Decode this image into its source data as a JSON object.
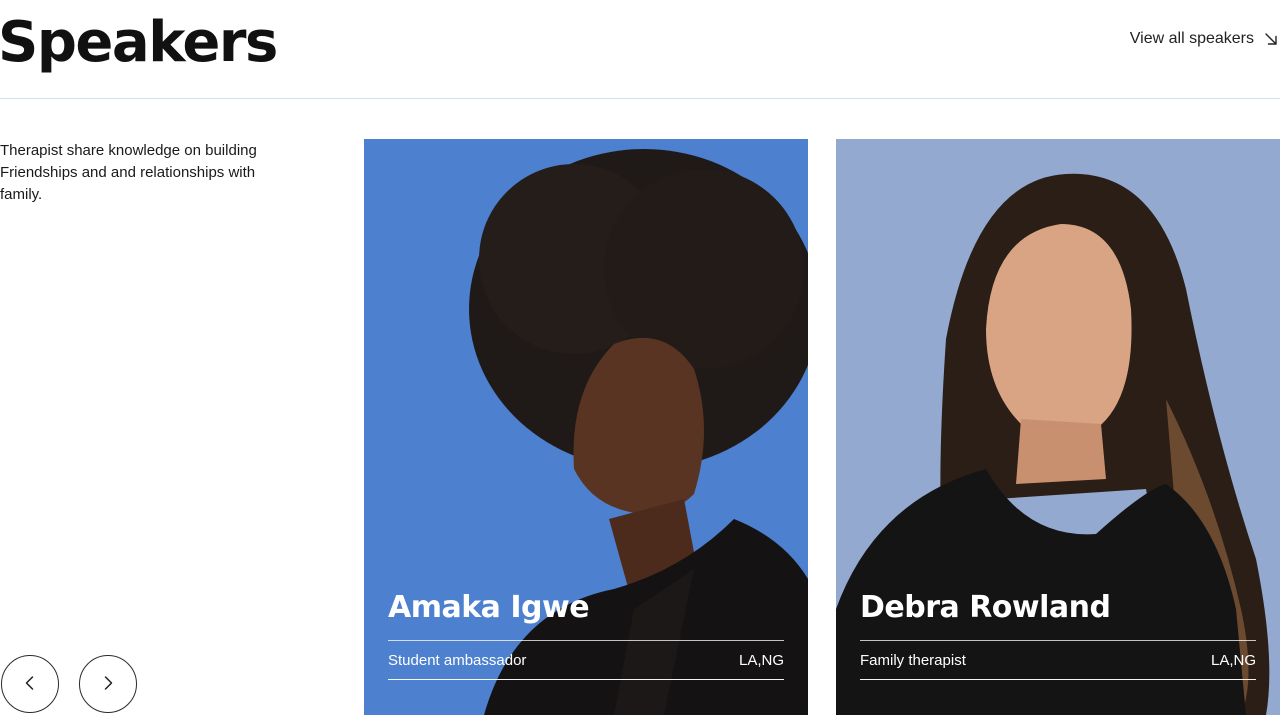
{
  "header": {
    "title": "Speakers",
    "view_all_label": "View all speakers"
  },
  "intro": {
    "description": "Therapist share knowledge on building Friendships and and relationships with family."
  },
  "carousel": {
    "prev_icon": "chevron-left-icon",
    "next_icon": "chevron-right-icon"
  },
  "speakers": [
    {
      "name": "Amaka Igwe",
      "role": "Student ambassador",
      "location": "LA,NG",
      "background": "#4d80cf"
    },
    {
      "name": "Debra Rowland",
      "role": "Family therapist",
      "location": "LA,NG",
      "background": "#93a9cf"
    }
  ],
  "colors": {
    "divider": "#cfe0ea",
    "text": "#111111"
  }
}
